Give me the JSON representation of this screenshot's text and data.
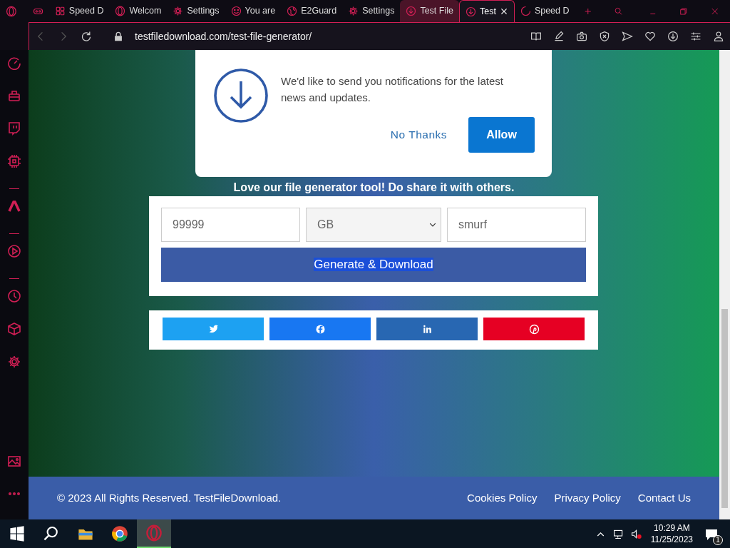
{
  "tabs": [
    {
      "kind": "gamepad",
      "selected": false,
      "hovered": false,
      "closable": false
    },
    {
      "kind": "grid",
      "label": "Speed D",
      "selected": false,
      "hovered": false,
      "closable": false
    },
    {
      "kind": "ring",
      "label": "Welcom",
      "selected": false,
      "hovered": false,
      "closable": false
    },
    {
      "kind": "gear",
      "label": "Settings",
      "selected": false,
      "hovered": false,
      "closable": false
    },
    {
      "kind": "smiley",
      "label": "You are",
      "selected": false,
      "hovered": false,
      "closable": false
    },
    {
      "kind": "globe",
      "label": "E2Guard",
      "selected": false,
      "hovered": false,
      "closable": false
    },
    {
      "kind": "gear",
      "label": "Settings",
      "selected": false,
      "hovered": false,
      "closable": false
    },
    {
      "kind": "download",
      "label": "Test File",
      "selected": false,
      "hovered": true,
      "closable": false
    },
    {
      "kind": "download",
      "label": "Test",
      "selected": true,
      "hovered": false,
      "closable": true
    },
    {
      "kind": "spinner",
      "label": "Speed D",
      "selected": false,
      "hovered": false,
      "closable": false
    }
  ],
  "address_bar": {
    "url": "testfiledownload.com/test-file-generator/"
  },
  "toolbar": [
    {
      "kind": "book"
    },
    {
      "kind": "edit"
    },
    {
      "kind": "camera"
    },
    {
      "kind": "shield"
    },
    {
      "kind": "send"
    },
    {
      "kind": "heart"
    },
    {
      "kind": "download"
    },
    {
      "kind": "sliders"
    },
    {
      "kind": "person"
    }
  ],
  "sidebar": {
    "items": [
      {
        "kind": "gauge"
      },
      {
        "kind": "bag"
      },
      {
        "kind": "chat"
      },
      {
        "kind": "chip"
      },
      {
        "kind": "divider"
      },
      {
        "kind": "aria"
      },
      {
        "kind": "divider"
      },
      {
        "kind": "play"
      },
      {
        "kind": "divider"
      },
      {
        "kind": "clock"
      },
      {
        "kind": "cube"
      },
      {
        "kind": "gear"
      }
    ],
    "bottom": [
      {
        "kind": "image"
      },
      {
        "kind": "dots"
      }
    ]
  },
  "notification": {
    "message": "We'd like to send you notifications for the latest news and updates.",
    "buttons": [
      {
        "label": "No Thanks",
        "kind": "link"
      },
      {
        "label": "Allow",
        "kind": "primary"
      }
    ]
  },
  "tagline": "Love our file generator tool! Do share it with others.",
  "form": {
    "size": "99999",
    "unit": "GB",
    "name": "smurf",
    "button": "Generate & Download",
    "button_text_selected": true
  },
  "share": [
    {
      "kind": "bird",
      "color": "#1da1f2"
    },
    {
      "kind": "f",
      "color": "#1877f2"
    },
    {
      "kind": "in",
      "color": "#2867b2"
    },
    {
      "kind": "pin",
      "color": "#e60023"
    }
  ],
  "footer": {
    "copyright": "© 2023 All Rights Reserved. TestFileDownload.",
    "links": [
      "Cookies Policy",
      "Privacy Policy",
      "Contact Us"
    ]
  },
  "taskbar": {
    "apps": [
      {
        "kind": "folder",
        "active": false
      },
      {
        "kind": "browser",
        "active": false
      },
      {
        "kind": "ring",
        "active": true
      }
    ],
    "time": "10:29 AM",
    "date": "11/25/2023",
    "notifications": "1"
  }
}
